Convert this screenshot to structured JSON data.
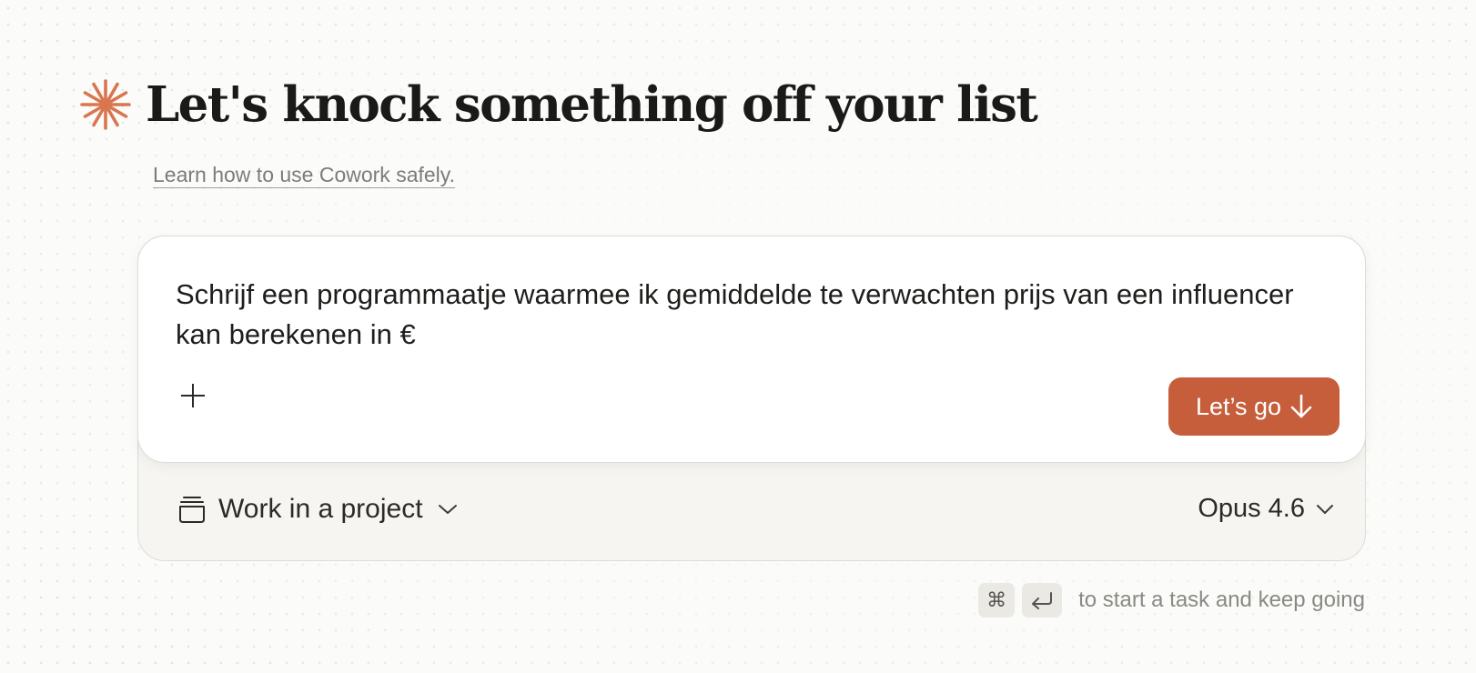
{
  "header": {
    "title": "Let's knock something off your list",
    "logo_icon": "sparkle-asterisk-icon",
    "accent_color": "#c65e3c"
  },
  "safety_link": {
    "label": "Learn how to use Cowork safely."
  },
  "composer": {
    "prompt": "Schrijf een programmaatje waarmee ik gemiddelde te verwachten prijs van een influencer kan berekenen in €",
    "add_icon": "plus-icon",
    "submit_label": "Let’s go",
    "submit_icon": "arrow-down-icon"
  },
  "footer_bar": {
    "project_icon": "stack-box-icon",
    "project_label": "Work in a project",
    "model_label": "Opus 4.6",
    "chevron_icon": "chevron-down-icon"
  },
  "hint": {
    "cmd_key": "⌘",
    "enter_icon": "return-key-icon",
    "text": "to start a task and keep going"
  }
}
